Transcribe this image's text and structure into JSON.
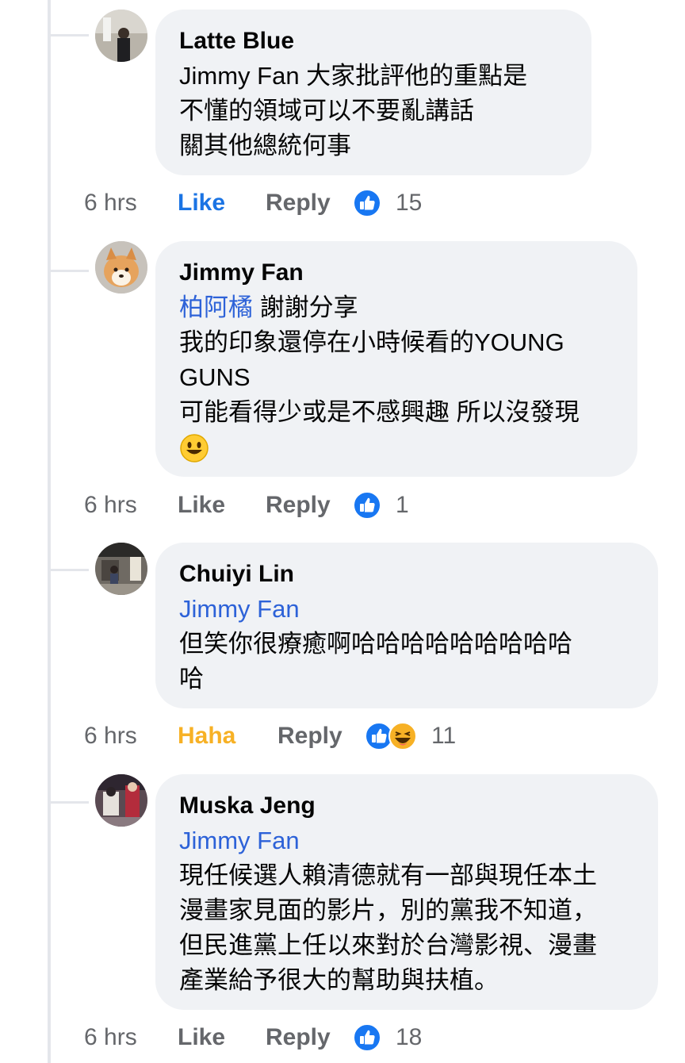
{
  "comments": [
    {
      "author": "Latte Blue",
      "mention": "",
      "lines": [
        "Jimmy  Fan 大家批評他的重點是",
        "不懂的領域可以不要亂講話",
        "關其他總統何事"
      ],
      "time": "6 hrs",
      "like_label": "Like",
      "like_state": "liked",
      "reply_label": "Reply",
      "reactions": [
        "like-icon"
      ],
      "count": "15"
    },
    {
      "author": "Jimmy  Fan",
      "mention": "柏阿橘",
      "mention_suffix": " 謝謝分享",
      "lines": [
        "我的印象還停在小時候看的YOUNG",
        "GUNS",
        "可能看得少或是不感興趣 所以沒發現"
      ],
      "emoji": "smile-emoji",
      "time": "6 hrs",
      "like_label": "Like",
      "like_state": "none",
      "reply_label": "Reply",
      "reactions": [
        "like-icon"
      ],
      "count": "1"
    },
    {
      "author": "Chuiyi Lin",
      "mention": "Jimmy  Fan",
      "lines": [
        "但笑你很療癒啊哈哈哈哈哈哈哈哈哈",
        "哈"
      ],
      "time": "6 hrs",
      "like_label": "Haha",
      "like_state": "haha",
      "reply_label": "Reply",
      "reactions": [
        "like-icon",
        "haha-icon"
      ],
      "count": "11"
    },
    {
      "author": "Muska Jeng",
      "mention": "Jimmy  Fan",
      "lines": [
        "現任候選人賴清德就有一部與現任本土",
        "漫畫家見面的影片，別的黨我不知道，",
        "但民進黨上任以來對於台灣影視、漫畫",
        "產業給予很大的幫助與扶植。"
      ],
      "time": "6 hrs",
      "like_label": "Like",
      "like_state": "none",
      "reply_label": "Reply",
      "reactions": [
        "like-icon"
      ],
      "count": "18"
    }
  ],
  "colors": {
    "link": "#2d62d8",
    "liked": "#1b74e4",
    "haha": "#f7b125",
    "bubble": "#f0f2f5"
  }
}
